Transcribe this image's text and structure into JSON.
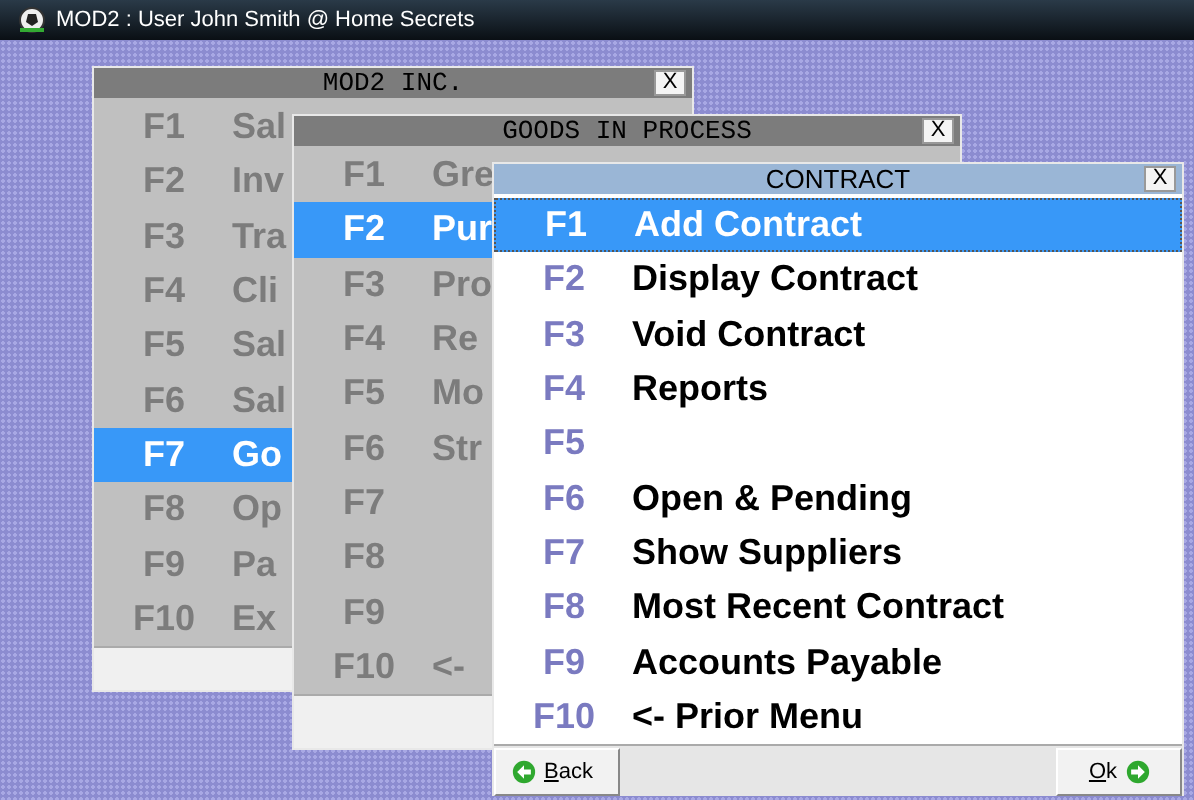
{
  "app_title": "MOD2 : User John Smith @ Home Secrets",
  "windows": [
    {
      "title": "MOD2 INC.",
      "close": "X",
      "focused": false,
      "items": [
        {
          "key": "F1",
          "label": "Sal",
          "selected": false
        },
        {
          "key": "F2",
          "label": "Inv",
          "selected": false
        },
        {
          "key": "F3",
          "label": "Tra",
          "selected": false
        },
        {
          "key": "F4",
          "label": "Cli",
          "selected": false
        },
        {
          "key": "F5",
          "label": "Sal",
          "selected": false
        },
        {
          "key": "F6",
          "label": "Sal",
          "selected": false
        },
        {
          "key": "F7",
          "label": "Go",
          "selected": true
        },
        {
          "key": "F8",
          "label": "Op",
          "selected": false
        },
        {
          "key": "F9",
          "label": "Pa",
          "selected": false
        },
        {
          "key": "F10",
          "label": "Ex",
          "selected": false
        }
      ]
    },
    {
      "title": "GOODS IN PROCESS",
      "close": "X",
      "focused": false,
      "items": [
        {
          "key": "F1",
          "label": "Gre",
          "selected": false
        },
        {
          "key": "F2",
          "label": "Pur",
          "selected": true
        },
        {
          "key": "F3",
          "label": "Pro",
          "selected": false
        },
        {
          "key": "F4",
          "label": "Re",
          "selected": false
        },
        {
          "key": "F5",
          "label": "Mo",
          "selected": false
        },
        {
          "key": "F6",
          "label": "Str",
          "selected": false
        },
        {
          "key": "F7",
          "selected": false
        },
        {
          "key": "F8",
          "selected": false
        },
        {
          "key": "F9",
          "selected": false
        },
        {
          "key": "F10",
          "label": "<-",
          "selected": false
        }
      ]
    },
    {
      "title": "CONTRACT",
      "close": "X",
      "focused": true,
      "items": [
        {
          "key": "F1",
          "label": "Add Contract",
          "selected": true
        },
        {
          "key": "F2",
          "label": "Display Contract",
          "selected": false
        },
        {
          "key": "F3",
          "label": "Void Contract",
          "selected": false
        },
        {
          "key": "F4",
          "label": "Reports",
          "selected": false
        },
        {
          "key": "F5",
          "selected": false
        },
        {
          "key": "F6",
          "label": "Open & Pending",
          "selected": false
        },
        {
          "key": "F7",
          "label": "Show Suppliers",
          "selected": false
        },
        {
          "key": "F8",
          "label": "Most Recent Contract",
          "selected": false
        },
        {
          "key": "F9",
          "label": "Accounts Payable",
          "selected": false
        },
        {
          "key": "F10",
          "label": "<- Prior Menu",
          "selected": false
        }
      ],
      "buttons": [
        {
          "kind": "back",
          "label": "Back"
        },
        {
          "kind": "ok",
          "label": "Ok"
        }
      ]
    }
  ]
}
